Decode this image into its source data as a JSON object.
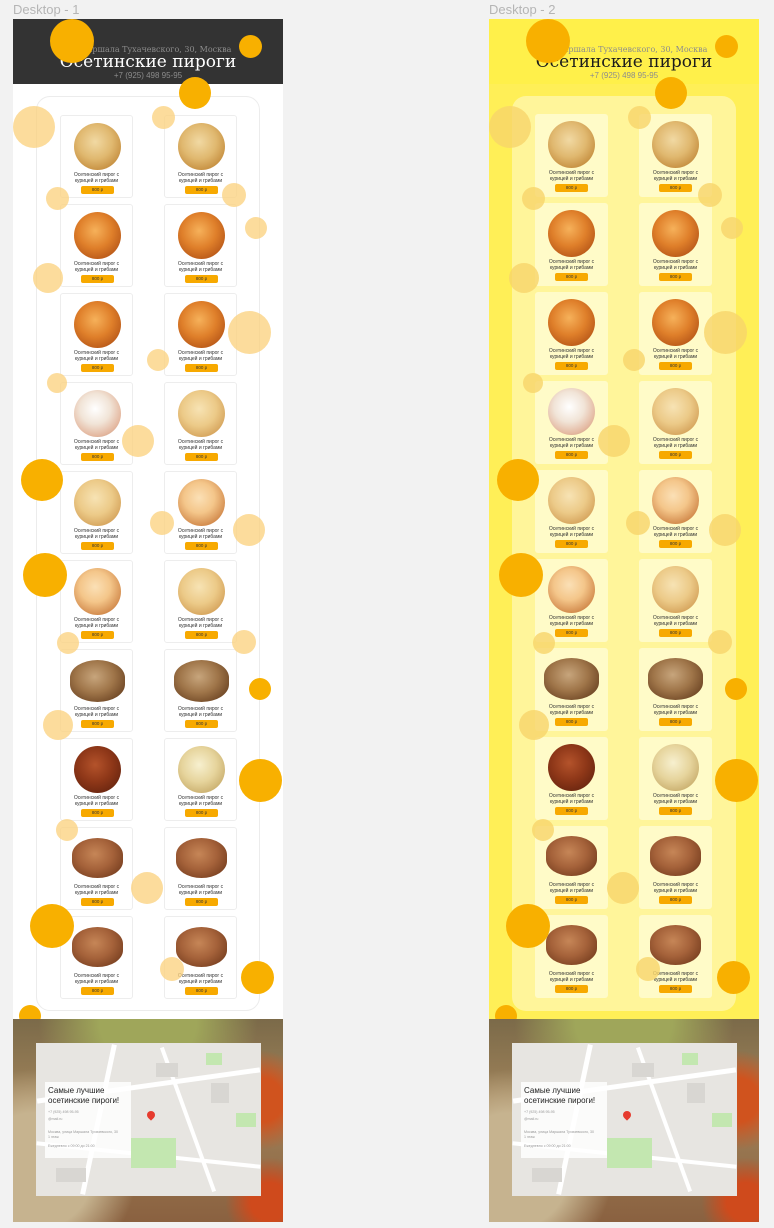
{
  "frames": [
    {
      "title": "Desktop - 1",
      "header": {
        "address": "ул. Маршала Тухачевского, 30, Москва",
        "title": "Осетинские пироги",
        "phone": "+7 (925) 498 95-95"
      }
    },
    {
      "title": "Desktop - 2",
      "header": {
        "address": "ул. Маршала Тухачевского, 30, Москва",
        "title": "Осетинские пироги",
        "phone": "+7 (925) 498 95-95"
      }
    }
  ],
  "products": [
    {
      "name": "Осетинский пирог с курицей и грибами",
      "price": "800 р",
      "image": "pie-golden"
    },
    {
      "name": "Осетинский пирог с курицей и грибами",
      "price": "800 р",
      "image": "pie-golden"
    },
    {
      "name": "Осетинский пирог с курицей и грибами",
      "price": "800 р",
      "image": "pie-browned"
    },
    {
      "name": "Осетинский пирог с курицей и грибами",
      "price": "800 р",
      "image": "pie-browned"
    },
    {
      "name": "Осетинский пирог с курицей и грибами",
      "price": "800 р",
      "image": "pie-browned"
    },
    {
      "name": "Осетинский пирог с курицей и грибами",
      "price": "800 р",
      "image": "pie-browned"
    },
    {
      "name": "Осетинский пирог с курицей и грибами",
      "price": "800 р",
      "image": "pie-cheese-herbs"
    },
    {
      "name": "Осетинский пирог с курицей и грибами",
      "price": "800 р",
      "image": "pie-light"
    },
    {
      "name": "Осетинский пирог с курицей и грибами",
      "price": "800 р",
      "image": "pie-light"
    },
    {
      "name": "Осетинский пирог с курицей и грибами",
      "price": "800 р",
      "image": "pie-lattice"
    },
    {
      "name": "Осетинский пирог с курицей и грибами",
      "price": "800 р",
      "image": "pie-lattice"
    },
    {
      "name": "Осетинский пирог с курицей и грибами",
      "price": "800 р",
      "image": "pie-light"
    },
    {
      "name": "Осетинский пирог с курицей и грибами",
      "price": "800 р",
      "image": "pie-dark-oval"
    },
    {
      "name": "Осетинский пирог с курицей и грибами",
      "price": "800 р",
      "image": "pie-dark-oval"
    },
    {
      "name": "Осетинский пирог с курицей и грибами",
      "price": "800 р",
      "image": "pie-dark-red"
    },
    {
      "name": "Осетинский пирог с курицей и грибами",
      "price": "800 р",
      "image": "pie-pale"
    },
    {
      "name": "Осетинский пирог с курицей и грибами",
      "price": "800 р",
      "image": "pie-meat"
    },
    {
      "name": "Осетинский пирог с курицей и грибами",
      "price": "800 р",
      "image": "pie-meat"
    },
    {
      "name": "Осетинский пирог с курицей и грибами",
      "price": "800 р",
      "image": "pie-meat"
    },
    {
      "name": "Осетинский пирог с курицей и грибами",
      "price": "800 р",
      "image": "pie-meat"
    }
  ],
  "footer": {
    "title": "Самые лучшие осетинские пироги!",
    "phone": "+7 (925) 498 95-95",
    "email": "@mail.ru",
    "address": "Москва, улица Маршала Тухачевского, 30\n1 этаж",
    "hours": "Ежедневно с 09:00 до 21:00"
  },
  "colors": {
    "accent": "#f7a900",
    "header_dark": "#333333",
    "yellow_bg": "#ffef57"
  }
}
